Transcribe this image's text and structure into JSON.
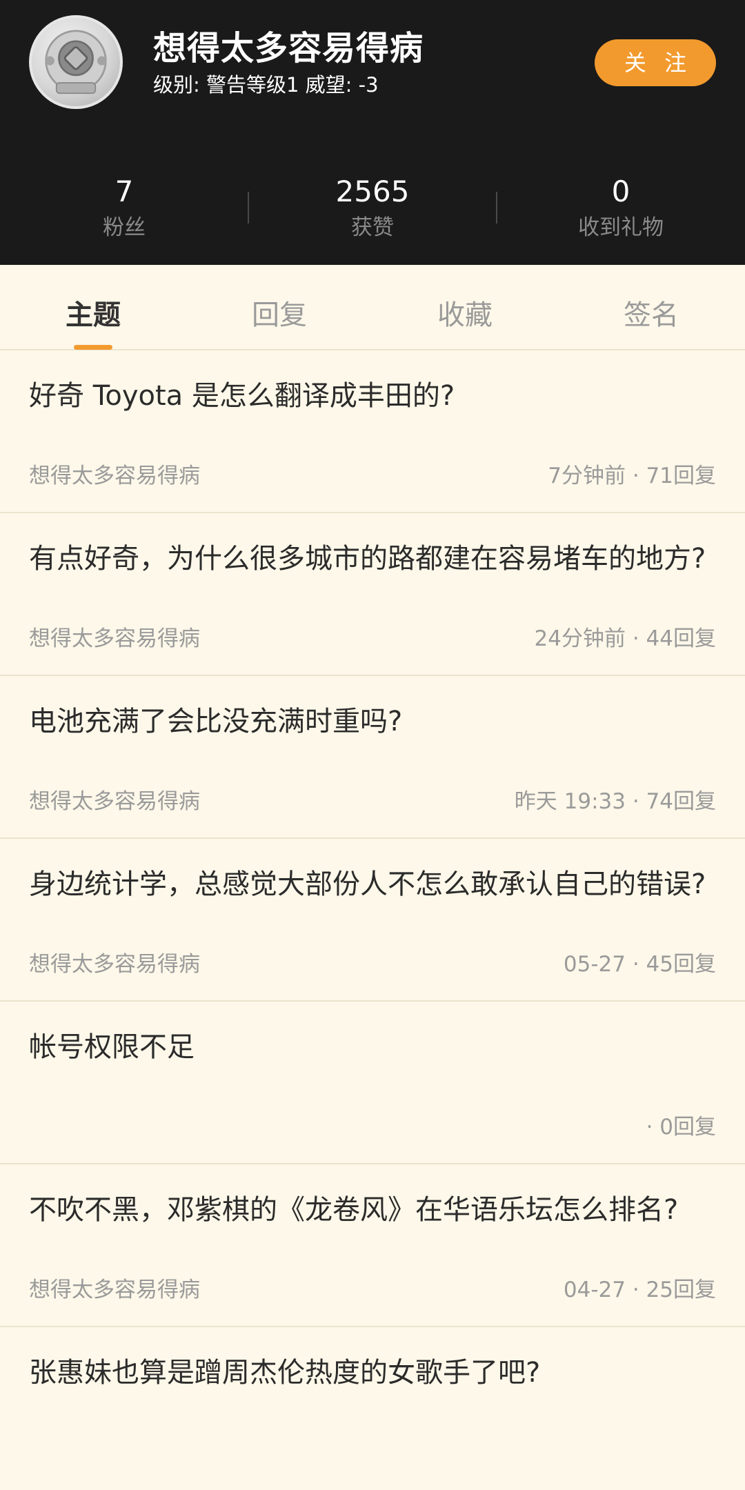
{
  "profile": {
    "username": "想得太多容易得病",
    "level_text": "级别: 警告等级1 威望: -3",
    "follow_label": "关 注"
  },
  "stats": [
    {
      "value": "7",
      "label": "粉丝"
    },
    {
      "value": "2565",
      "label": "获赞"
    },
    {
      "value": "0",
      "label": "收到礼物"
    }
  ],
  "tabs": [
    {
      "label": "主题",
      "active": true
    },
    {
      "label": "回复",
      "active": false
    },
    {
      "label": "收藏",
      "active": false
    },
    {
      "label": "签名",
      "active": false
    }
  ],
  "posts": [
    {
      "title": "好奇 Toyota 是怎么翻译成丰田的?",
      "author": "想得太多容易得病",
      "meta": "7分钟前 · 71回复"
    },
    {
      "title": "有点好奇，为什么很多城市的路都建在容易堵车的地方?",
      "author": "想得太多容易得病",
      "meta": "24分钟前 · 44回复"
    },
    {
      "title": "电池充满了会比没充满时重吗?",
      "author": "想得太多容易得病",
      "meta": "昨天 19:33 · 74回复"
    },
    {
      "title": "身边统计学，总感觉大部份人不怎么敢承认自己的错误?",
      "author": "想得太多容易得病",
      "meta": "05-27 · 45回复"
    },
    {
      "title": "帐号权限不足",
      "author": "",
      "meta": "· 0回复"
    },
    {
      "title": "不吹不黑，邓紫棋的《龙卷风》在华语乐坛怎么排名?",
      "author": "想得太多容易得病",
      "meta": "04-27 · 25回复"
    },
    {
      "title": "张惠妹也算是蹭周杰伦热度的女歌手了吧?",
      "author": "",
      "meta": ""
    }
  ],
  "colors": {
    "header_bg": "#1a1a1a",
    "accent": "#f29a2e",
    "page_bg": "#fdf8e9"
  }
}
